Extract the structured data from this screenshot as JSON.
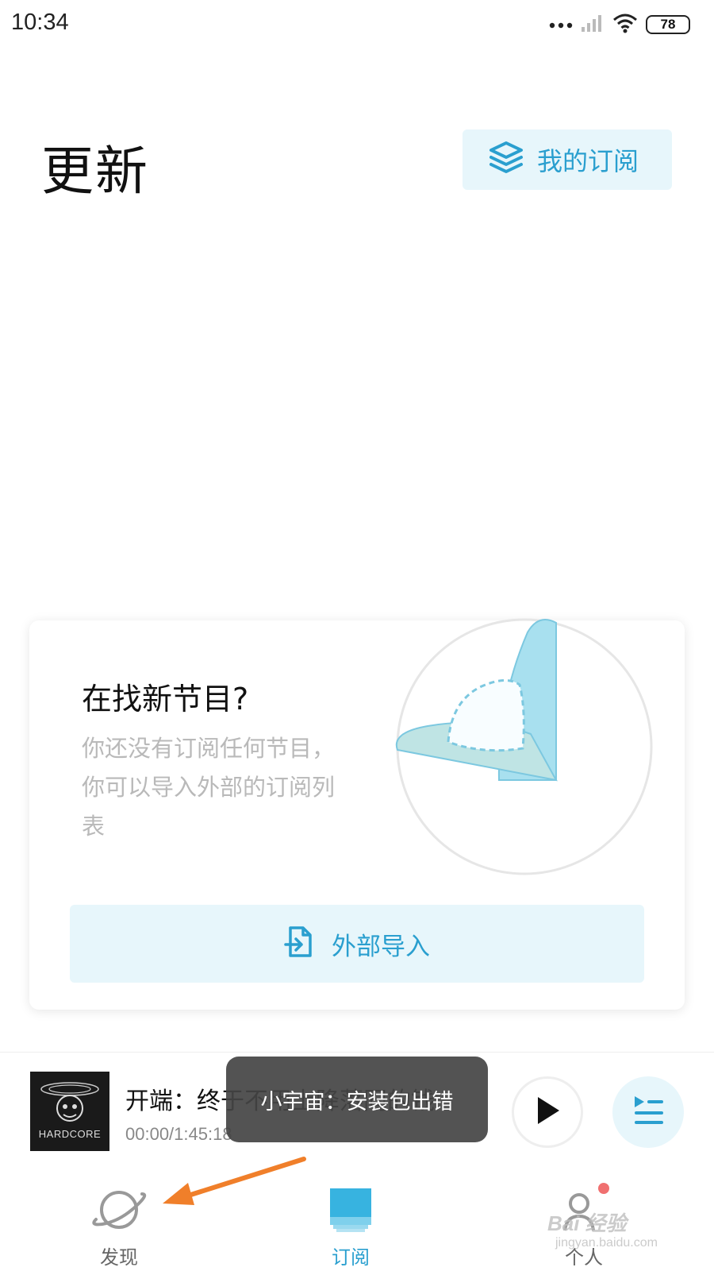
{
  "status_bar": {
    "time": "10:34",
    "battery": "78",
    "icons": [
      "more-dots-icon",
      "signal-icon",
      "wifi-icon",
      "battery-icon"
    ]
  },
  "header": {
    "title": "更新",
    "my_subscriptions_label": "我的订阅",
    "my_subscriptions_icon": "layers-icon"
  },
  "empty_card": {
    "title": "在找新节目?",
    "description": "你还没有订阅任何节目，你可以导入外部的订阅列表",
    "import_button_label": "外部导入",
    "import_icon": "import-file-icon"
  },
  "player": {
    "cover_text": "HARDCORE",
    "episode_title": "开端：终于不用上降落同的钱",
    "time": "00:00/1:45:18",
    "play_icon": "play-icon",
    "playlist_icon": "playlist-icon"
  },
  "toast": {
    "message": "小宇宙：安装包出错"
  },
  "bottom_nav": {
    "items": [
      {
        "label": "发现",
        "icon": "planet-icon",
        "active": false
      },
      {
        "label": "订阅",
        "icon": "subscription-icon",
        "active": true
      },
      {
        "label": "个人",
        "icon": "person-icon",
        "active": false
      }
    ]
  },
  "colors": {
    "accent": "#2a9fcf",
    "accent_bg": "#e7f6fb",
    "annotation_arrow": "#f07f2a"
  },
  "watermark": {
    "brand": "Bai 经验",
    "url": "jingyan.baidu.com"
  }
}
